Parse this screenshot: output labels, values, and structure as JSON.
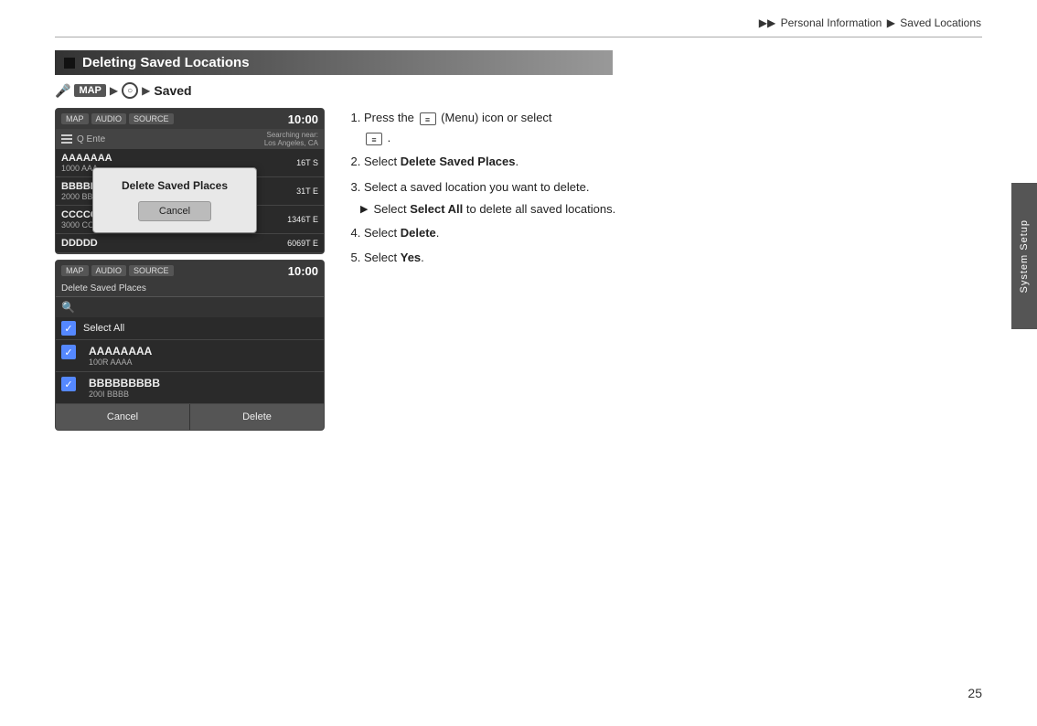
{
  "breadcrumb": {
    "prefix": "▶▶",
    "part1": "Personal Information",
    "arrow1": "▶",
    "part2": "Saved Locations"
  },
  "sidebar": {
    "label": "System Setup"
  },
  "page_number": "25",
  "section": {
    "title": "Deleting Saved Locations"
  },
  "nav": {
    "mic": "🎤",
    "map_badge": "MAP",
    "arrow1": "▶",
    "circle": "⊙",
    "arrow2": "▶",
    "saved": "Saved"
  },
  "screen1": {
    "tabs": [
      "MAP",
      "AUDIO",
      "SOURCE"
    ],
    "time": "10:00",
    "search_placeholder": "Ente",
    "nearby": "Searching near:\nLos Angeles, CA",
    "dialog_title": "Delete Saved Places",
    "cancel_btn": "Cancel",
    "locations": [
      {
        "name": "AAAAAAA",
        "addr": "1000 AAA",
        "dist": "16T S"
      },
      {
        "name": "BBBBBBB",
        "addr": "2000 BBB",
        "dist": "31T E"
      },
      {
        "name": "CCCCC",
        "addr": "3000 CCC",
        "dist": "1346T E"
      },
      {
        "name": "DDDDD",
        "addr": "",
        "dist": "6069T E"
      }
    ]
  },
  "screen2": {
    "tabs": [
      "MAP",
      "AUDIO",
      "SOURCE"
    ],
    "time": "10:00",
    "delete_header": "Delete Saved Places",
    "select_all": "Select All",
    "locations": [
      {
        "name": "AAAAAAAA",
        "addr": "100R AAAA"
      },
      {
        "name": "BBBBBBBBB",
        "addr": "200I BBBB"
      }
    ],
    "cancel_btn": "Cancel",
    "delete_btn": "Delete"
  },
  "instructions": {
    "step1": "Press the",
    "step1_menu": "(Menu) icon or select",
    "step1_end": ".",
    "step2": "Select",
    "step2_bold": "Delete Saved Places",
    "step2_end": ".",
    "step3_intro": "Select a saved location you want to delete.",
    "step3_sub_arrow": "▶",
    "step3_sub": "Select",
    "step3_sub_bold": "Select All",
    "step3_sub_end": "to delete all saved locations.",
    "step4": "Select",
    "step4_bold": "Delete",
    "step4_end": ".",
    "step5": "Select",
    "step5_bold": "Yes",
    "step5_end": "."
  }
}
